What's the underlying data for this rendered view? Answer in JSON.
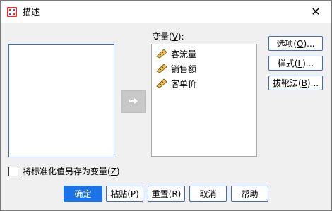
{
  "window": {
    "title": "描述",
    "close_label": "✕"
  },
  "source_list": {
    "items": []
  },
  "target": {
    "label_prefix": "变量(",
    "label_key": "V",
    "label_suffix": "):",
    "variables": [
      {
        "name": "客流量",
        "icon": "ruler-scale-icon"
      },
      {
        "name": "销售额",
        "icon": "ruler-scale-icon"
      },
      {
        "name": "客单价",
        "icon": "ruler-scale-icon"
      }
    ]
  },
  "side_buttons": {
    "options": {
      "prefix": "选项(",
      "key": "O",
      "suffix": ")..."
    },
    "style": {
      "prefix": "样式(",
      "key": "L",
      "suffix": ")..."
    },
    "bootstrap": {
      "prefix": "拔靴法(",
      "key": "B",
      "suffix": ")..."
    }
  },
  "checkbox": {
    "prefix": "将标准化值另存为变量(",
    "key": "Z",
    "suffix": ")",
    "checked": false
  },
  "bottom_buttons": {
    "ok": "确定",
    "paste": {
      "prefix": "粘贴(",
      "key": "P",
      "suffix": ")"
    },
    "reset": {
      "prefix": "重置(",
      "key": "R",
      "suffix": ")"
    },
    "cancel": "取消",
    "help": "帮助"
  },
  "colors": {
    "accent": "#1a73e8",
    "focus_border": "#3a6bd4",
    "move_button": "#c8c8c8"
  }
}
